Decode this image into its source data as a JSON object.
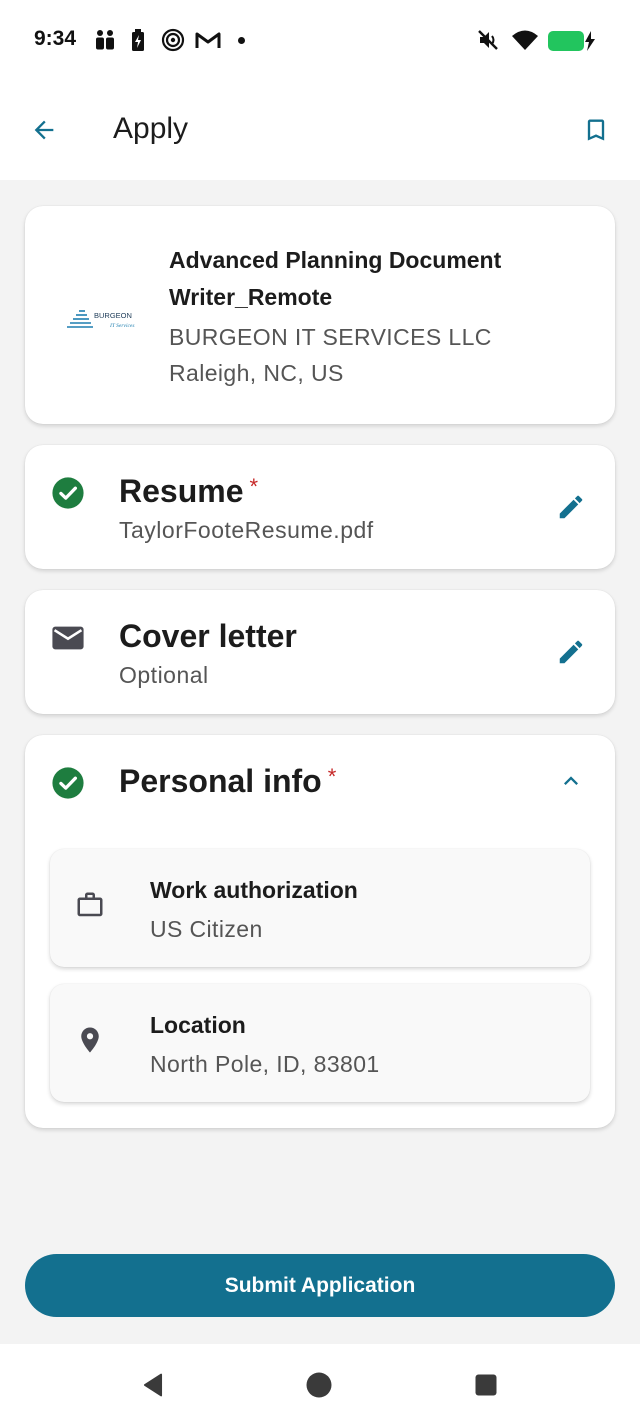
{
  "status_bar": {
    "time": "9:34",
    "icons": [
      "people-icon",
      "battery-saver-icon",
      "spiral-app-icon",
      "gmail-icon",
      "notification-dot",
      "mute-icon",
      "wifi-icon",
      "battery-charging-icon"
    ]
  },
  "app_bar": {
    "title": "Apply",
    "back_icon": "arrow-back-icon",
    "bookmark_icon": "bookmark-outline-icon"
  },
  "job": {
    "title": "Advanced Planning Document Writer_Remote",
    "company": "BURGEON IT SERVICES LLC",
    "location": "Raleigh, NC, US",
    "logo_text": "BURGEON",
    "logo_subtext": "IT Services"
  },
  "resume": {
    "title": "Resume",
    "required_mark": "*",
    "filename": "TaylorFooteResume.pdf",
    "status_icon": "check-circle-icon"
  },
  "cover_letter": {
    "title": "Cover letter",
    "subtitle": "Optional",
    "icon": "mail-icon"
  },
  "personal_info": {
    "title": "Personal info",
    "required_mark": "*",
    "status_icon": "check-circle-icon",
    "items": [
      {
        "label": "Work authorization",
        "value": "US Citizen",
        "icon": "briefcase-icon"
      },
      {
        "label": "Location",
        "value": "North Pole, ID, 83801",
        "icon": "location-pin-icon"
      }
    ]
  },
  "submit_label": "Submit Application",
  "colors": {
    "accent": "#13708f",
    "success": "#1e7d3f",
    "required": "#c62828"
  }
}
